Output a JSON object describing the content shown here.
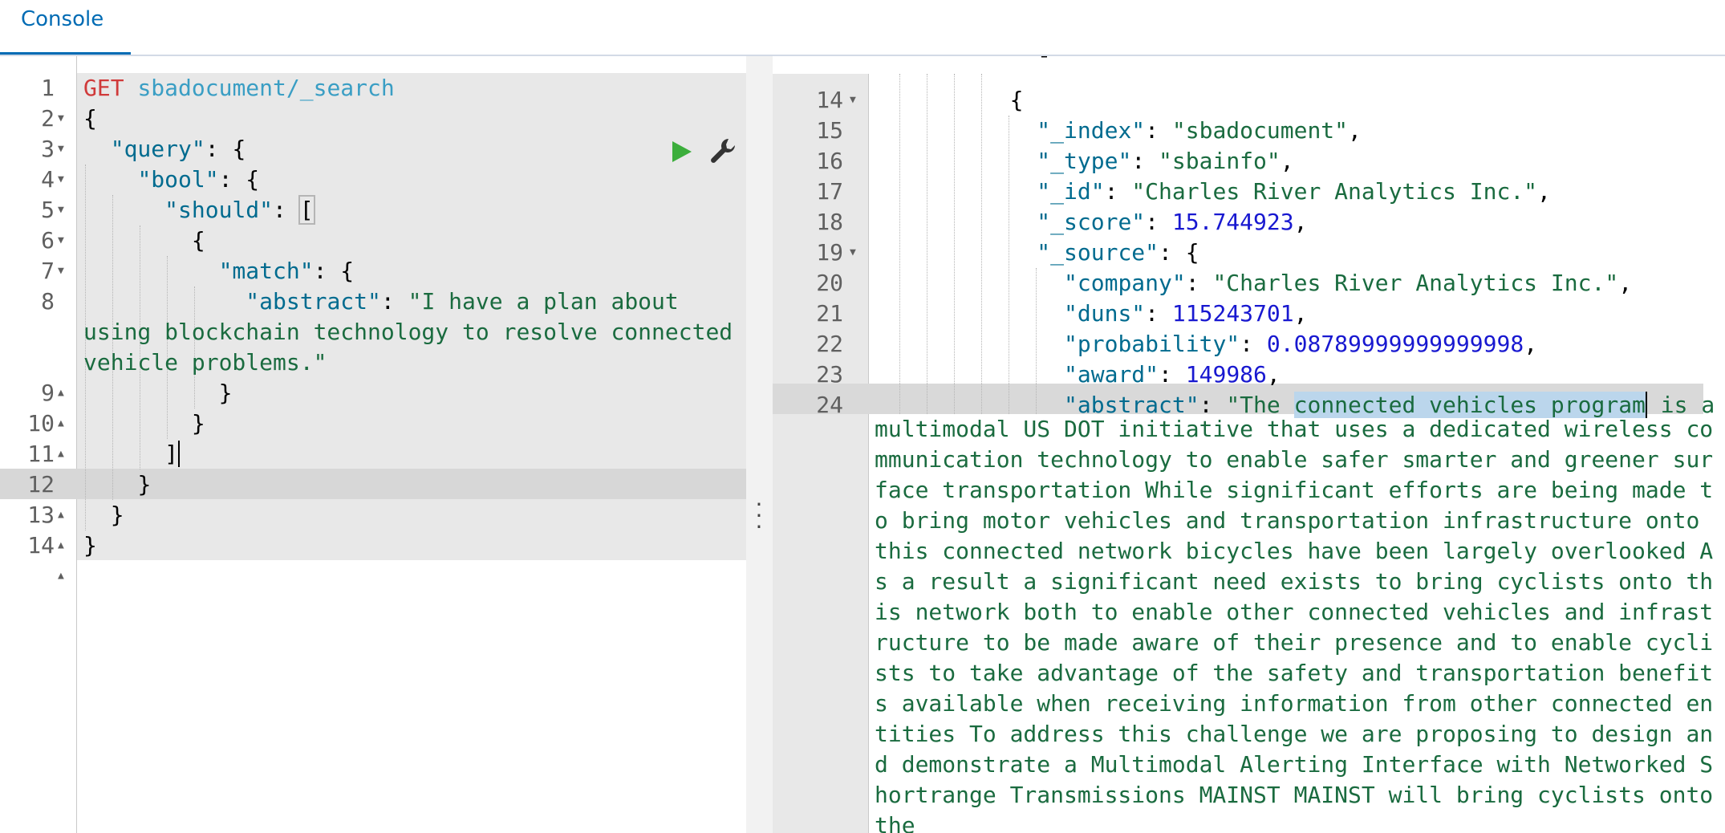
{
  "tabs": [
    {
      "label": "Console"
    }
  ],
  "request": {
    "method": "GET",
    "url": "sbadocument/_search",
    "line_numbers": [
      "1",
      "2",
      "3",
      "4",
      "5",
      "6",
      "7",
      "8",
      "9",
      "10",
      "11",
      "12",
      "13",
      "14"
    ],
    "lines": {
      "l2": "{",
      "l3_key": "\"query\"",
      "l4_key": "\"bool\"",
      "l5_key": "\"should\"",
      "l6": "{",
      "l7_key": "\"match\"",
      "l8_key": "\"abstract\"",
      "l8_value_1": "\"I have a plan about",
      "l8_value_2": "using blockchain technology to resolve connected",
      "l8_value_3": "vehicle problems.\"",
      "l9": "}",
      "l10": "}",
      "l11": "]",
      "l12": "}",
      "l13": "}",
      "l14": "}"
    }
  },
  "response": {
    "line_numbers": [
      "14",
      "15",
      "16",
      "17",
      "18",
      "19",
      "20",
      "21",
      "22",
      "23",
      "24"
    ],
    "lines": {
      "l14": "{",
      "l15_key": "\"_index\"",
      "l15_val": "\"sbadocument\"",
      "l16_key": "\"_type\"",
      "l16_val": "\"sbainfo\"",
      "l17_key": "\"_id\"",
      "l17_val": "\"Charles River Analytics Inc.\"",
      "l18_key": "\"_score\"",
      "l18_val": "15.744923",
      "l19_key": "\"_source\"",
      "l20_key": "\"company\"",
      "l20_val": "\"Charles River Analytics Inc.\"",
      "l21_key": "\"duns\"",
      "l21_val": "115243701",
      "l22_key": "\"probability\"",
      "l22_val": "0.08789999999999998",
      "l23_key": "\"award\"",
      "l23_val": "149986",
      "l24_key": "\"abstract\"",
      "l24_val_start": "\"The ",
      "l24_selected": "connected vehicles program",
      "l24_val_end": " is a",
      "abstract_wrapped": "multimodal US DOT initiative that uses a dedicated wireless communication technology to enable safer smarter and greener surface transportation While significant efforts are being made to bring motor vehicles and transportation infrastructure onto this connected network bicycles have been largely overlooked As a result a significant need exists to bring cyclists onto this network both to enable other connected vehicles and infrastructure to be made aware of their presence and to enable cyclists to take advantage of the safety and transportation benefits available when receiving information from other connected entities To address this challenge we are proposing to design and demonstrate a Multimodal Alerting Interface with Networked Shortrange Transmissions MAINST MAINST will bring cyclists onto the"
    }
  },
  "icons": {
    "run": "play-icon",
    "settings": "wrench-icon",
    "splitter": "kebab-icon"
  },
  "colors": {
    "accent": "#006bb4",
    "run": "#3cae3c",
    "method": "#d03a3a",
    "url": "#3a9ec4",
    "string": "#1a6b3f",
    "number": "#1818d0",
    "key": "#006b8f"
  }
}
